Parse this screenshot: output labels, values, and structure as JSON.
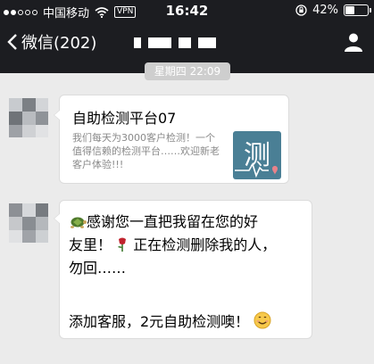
{
  "status_bar": {
    "carrier": "中国移动",
    "vpn_label": "VPN",
    "time": "16:42",
    "battery_text": "42%",
    "battery_level": 0.42
  },
  "navbar": {
    "back_label": "微信(202)"
  },
  "timestamp": "星期四 22:09",
  "link_card": {
    "title": "自助检测平台07",
    "description": "我们每天为3000客户检测！一个值得信赖的检测平台……欢迎新老客户体验!!!",
    "thumbnail_char": "测"
  },
  "message": {
    "line1": "感谢您一直把我留在您的好",
    "line2_a": "友里！",
    "line2_b": "正在检测删除我的人，",
    "line3": "勿回……",
    "line4": "添加客服，2元自助检测噢！"
  },
  "colors": {
    "header_bg": "#1c1d21",
    "chat_bg": "#ebebeb",
    "thumb_bg": "#4a7f95"
  },
  "icons": [
    "wifi-icon",
    "orientation-lock-icon",
    "battery-icon",
    "back-chevron-icon",
    "profile-icon",
    "turtle-emoji-icon",
    "rose-emoji-icon",
    "smile-emoji-icon"
  ]
}
